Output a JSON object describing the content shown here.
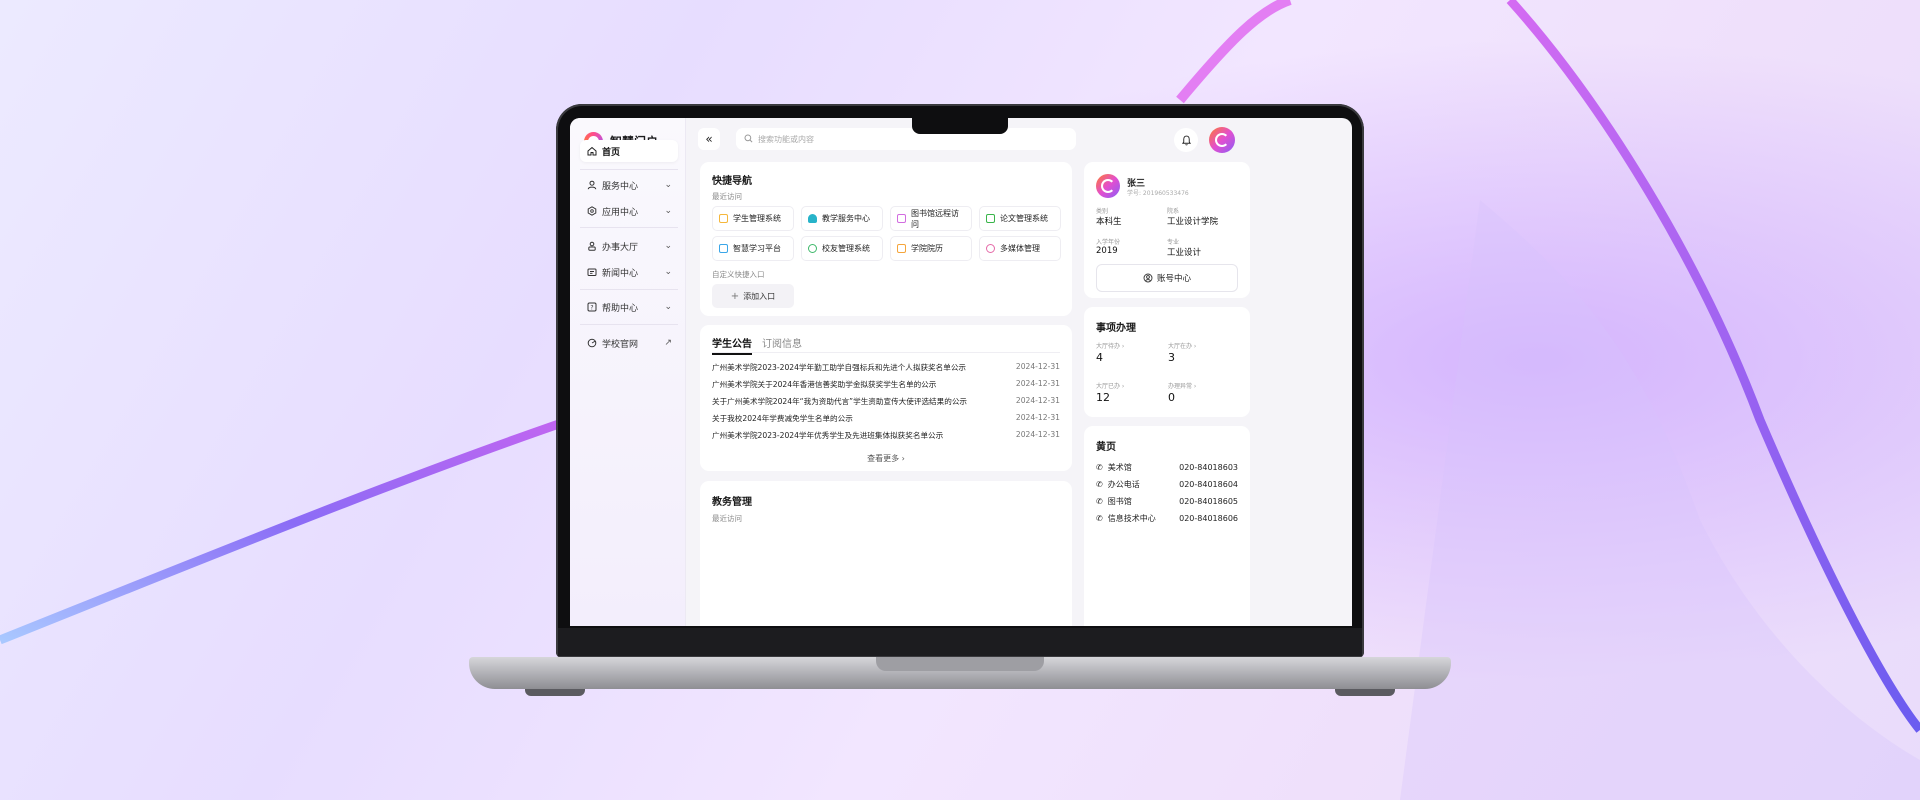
{
  "app": {
    "name": "智慧门户"
  },
  "sidebar": {
    "items": [
      {
        "label": "首页",
        "icon": "home-icon",
        "active": true
      },
      {
        "label": "服务中心",
        "icon": "user-icon"
      },
      {
        "label": "应用中心",
        "icon": "hexagon-icon"
      },
      {
        "label": "办事大厅",
        "icon": "person-icon"
      },
      {
        "label": "新闻中心",
        "icon": "newspaper-icon"
      },
      {
        "label": "帮助中心",
        "icon": "help-icon"
      },
      {
        "label": "学校官网",
        "icon": "globe-icon"
      }
    ]
  },
  "search": {
    "placeholder": "搜索功能或内容"
  },
  "quick_nav": {
    "title": "快捷导航",
    "recent_label": "最近访问",
    "items": [
      {
        "label": "学生管理系统",
        "color": "#f5b73b"
      },
      {
        "label": "教学服务中心",
        "color": "#27b3c9"
      },
      {
        "label": "图书馆远程访问",
        "color": "#d26ce0"
      },
      {
        "label": "论文管理系统",
        "color": "#39b54a"
      },
      {
        "label": "智慧学习平台",
        "color": "#3aa6e8"
      },
      {
        "label": "校友管理系统",
        "color": "#3fb86b"
      },
      {
        "label": "学院院历",
        "color": "#f5a53b"
      },
      {
        "label": "多媒体管理",
        "color": "#e56aa8"
      }
    ],
    "custom_label": "自定义快捷入口",
    "add_label": "添加入口"
  },
  "notices": {
    "tabs": [
      "学生公告",
      "订阅信息"
    ],
    "rows": [
      {
        "title": "广州美术学院2023-2024学年勤工助学自强标兵和先进个人拟获奖名单公示",
        "date": "2024-12-31"
      },
      {
        "title": "广州美术学院关于2024年香港信善奖助学金拟获奖学生名单的公示",
        "date": "2024-12-31"
      },
      {
        "title": "关于广州美术学院2024年“我为资助代言”学生资助宣传大使评选结果的公示",
        "date": "2024-12-31"
      },
      {
        "title": "关于我校2024年学费减免学生名单的公示",
        "date": "2024-12-31"
      },
      {
        "title": "广州美术学院2023-2024学年优秀学生及先进班集体拟获奖名单公示",
        "date": "2024-12-31"
      }
    ],
    "more_label": "查看更多"
  },
  "academic": {
    "title": "教务管理",
    "recent_label": "最近访问"
  },
  "profile": {
    "name": "张三",
    "id_text": "学号: 201960533476",
    "fields": [
      {
        "k": "类别",
        "v": "本科生"
      },
      {
        "k": "院系",
        "v": "工业设计学院"
      },
      {
        "k": "入学年份",
        "v": "2019"
      },
      {
        "k": "专业",
        "v": "工业设计"
      }
    ],
    "account_label": "账号中心"
  },
  "affairs": {
    "title": "事项办理",
    "stats": [
      {
        "k": "大厅待办",
        "v": "4"
      },
      {
        "k": "大厅在办",
        "v": "3"
      },
      {
        "k": "大厅已办",
        "v": "12"
      },
      {
        "k": "办理异常",
        "v": "0"
      }
    ]
  },
  "yellow_pages": {
    "title": "黄页",
    "rows": [
      {
        "name": "美术馆",
        "phone": "020-84018603"
      },
      {
        "name": "办公电话",
        "phone": "020-84018604"
      },
      {
        "name": "图书馆",
        "phone": "020-84018605"
      },
      {
        "name": "信息技术中心",
        "phone": "020-84018606"
      }
    ]
  }
}
